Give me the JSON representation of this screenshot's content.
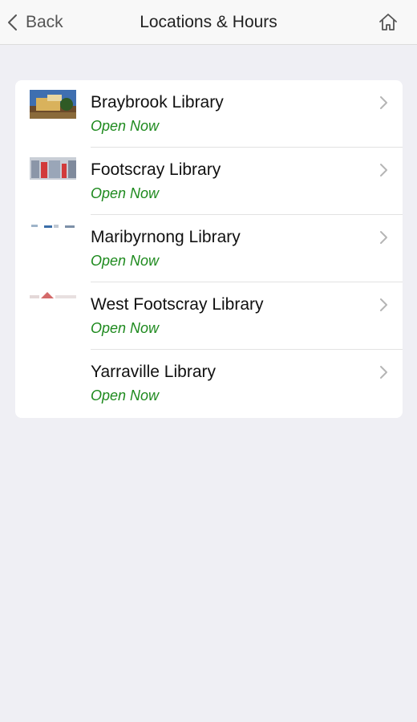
{
  "nav": {
    "back_label": "Back",
    "title": "Locations & Hours",
    "home_icon": "home-icon"
  },
  "locations": [
    {
      "name": "Braybrook Library",
      "status": "Open Now"
    },
    {
      "name": "Footscray Library",
      "status": "Open Now"
    },
    {
      "name": "Maribyrnong Library",
      "status": "Open Now"
    },
    {
      "name": "West Footscray Library",
      "status": "Open Now"
    },
    {
      "name": "Yarraville Library",
      "status": "Open Now"
    }
  ],
  "colors": {
    "status_open": "#1e8a1e",
    "background": "#efeff4"
  }
}
